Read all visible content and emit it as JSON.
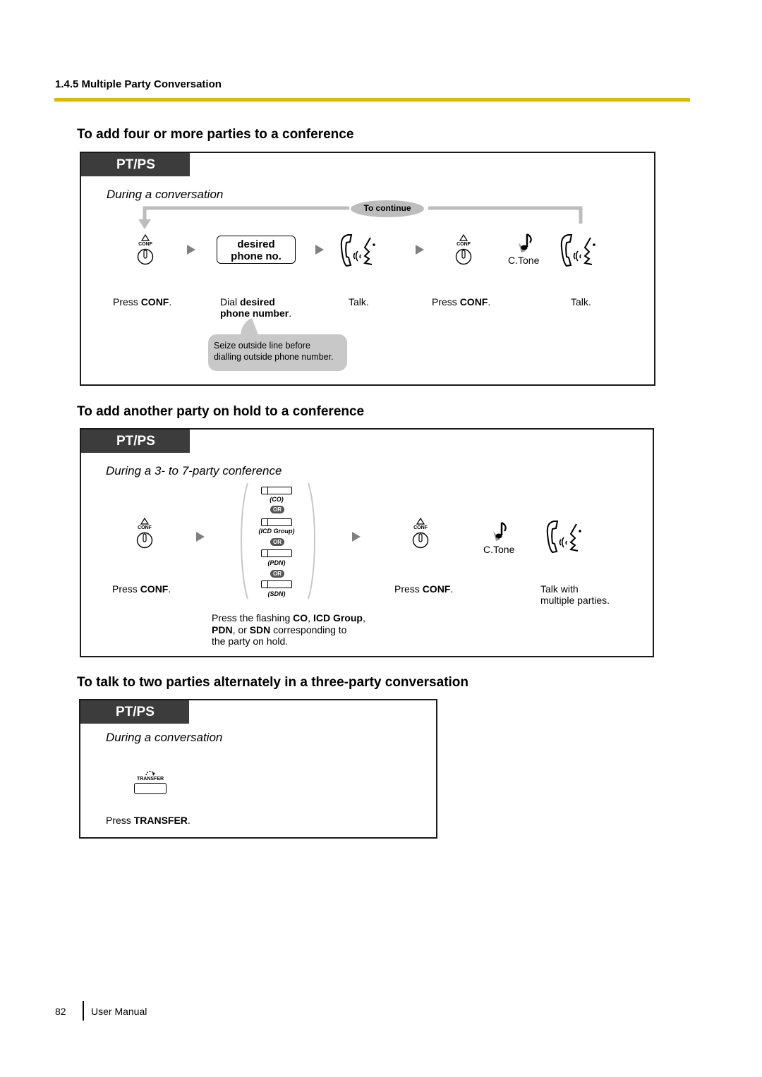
{
  "header": {
    "section": "1.4.5 Multiple Party Conversation",
    "rule_color": "#e0b800"
  },
  "sections": [
    {
      "title": "To add four or more parties to a conference",
      "tab": "PT/PS",
      "context": "During a conversation",
      "loop_label": "To continue",
      "key_label_line1": "desired",
      "key_label_line2": "phone no.",
      "conf_icon_label": "CONF",
      "ctone": "C.Tone",
      "steps": [
        {
          "pre": "Press ",
          "bold": "CONF",
          "post": "."
        },
        {
          "pre": "Dial ",
          "bold": "desired",
          "line2_bold": "phone number",
          "post": "."
        },
        {
          "text": "Talk."
        },
        {
          "pre": "Press ",
          "bold": "CONF",
          "post": "."
        },
        {
          "text": "Talk."
        }
      ],
      "note": {
        "line1": "Seize outside line before",
        "line2": "dialling outside phone number."
      }
    },
    {
      "title": "To add another party on hold to a conference",
      "tab": "PT/PS",
      "context": "During a 3- to 7-party conference",
      "conf_icon_label": "CONF",
      "ctone": "C.Tone",
      "flex_keys": [
        "(CO)",
        "(ICD Group)",
        "(PDN)",
        "(SDN)"
      ],
      "or_label": "OR",
      "steps": [
        {
          "pre": "Press ",
          "bold": "CONF",
          "post": "."
        },
        {
          "l1_pre": "Press the flashing ",
          "l1_b1": "CO",
          "l1_mid": ", ",
          "l1_b2": "ICD Group",
          "l1_post": ",",
          "l2_b1": "PDN",
          "l2_mid": ", or ",
          "l2_b2": "SDN",
          "l2_post": " corresponding to",
          "l3": "the party on hold."
        },
        {
          "pre": "Press ",
          "bold": "CONF",
          "post": "."
        },
        {
          "line1": "Talk with",
          "line2": "multiple parties."
        }
      ]
    },
    {
      "title": "To talk to two parties alternately in a three-party conversation",
      "tab": "PT/PS",
      "context": "During a conversation",
      "transfer_icon_label": "TRANSFER",
      "steps": [
        {
          "pre": "Press ",
          "bold": "TRANSFER",
          "post": "."
        }
      ]
    }
  ],
  "footer": {
    "page_number": "82",
    "doc_title": "User Manual"
  }
}
